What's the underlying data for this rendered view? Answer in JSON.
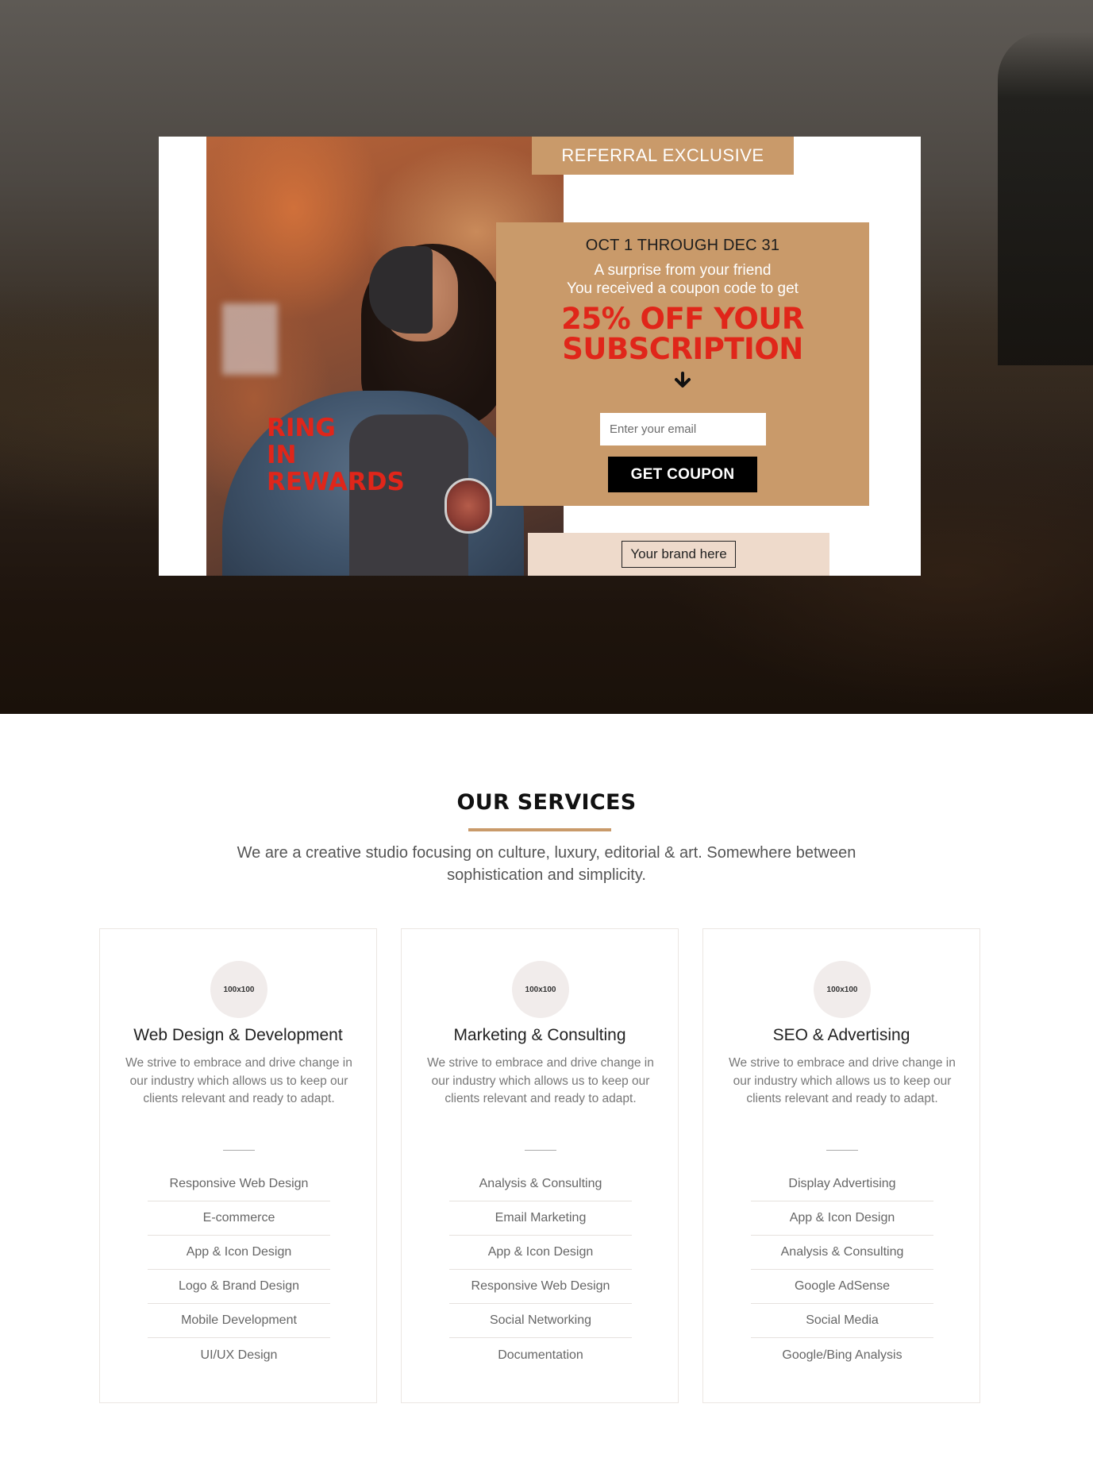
{
  "hero": {
    "tag": "REFERRAL EXCLUSIVE",
    "headline_lines": [
      "RING",
      "IN",
      "REWARDS"
    ],
    "promo": {
      "dates": "OCT 1 THROUGH DEC 31",
      "line1": "A surprise from your friend",
      "line2": "You received a coupon code to get",
      "offer_line1": "25% OFF YOUR",
      "offer_line2": "SUBSCRIPTION",
      "arrow_icon": "arrow-down-icon",
      "email_placeholder": "Enter your email",
      "button_label": "GET COUPON"
    },
    "brand_label": "Your brand here"
  },
  "services": {
    "title": "OUR SERVICES",
    "intro": "We are a creative studio focusing on culture, luxury, editorial & art. Somewhere between sophistication and simplicity.",
    "columns": [
      {
        "image_label": "100x100",
        "name": "Web Design & Development",
        "desc": "We strive to embrace and drive change in our industry which allows us to keep our clients relevant and ready to adapt.",
        "items": [
          "Responsive Web Design",
          "E-commerce",
          "App & Icon Design",
          "Logo & Brand Design",
          "Mobile Development",
          "UI/UX Design"
        ]
      },
      {
        "image_label": "100x100",
        "name": "Marketing & Consulting",
        "desc": "We strive to embrace and drive change in our industry which allows us to keep our clients relevant and ready to adapt.",
        "items": [
          "Analysis & Consulting",
          "Email Marketing",
          "App & Icon Design",
          "Responsive Web Design",
          "Social Networking",
          "Documentation"
        ]
      },
      {
        "image_label": "100x100",
        "name": "SEO & Advertising",
        "desc": "We strive to embrace and drive change in our industry which allows us to keep our clients relevant and ready to adapt.",
        "items": [
          "Display Advertising",
          "App & Icon Design",
          "Analysis & Consulting",
          "Google AdSense",
          "Social Media",
          "Google/Bing Analysis"
        ]
      }
    ]
  },
  "colors": {
    "accent": "#c99a6a",
    "offer_red": "#e0261a",
    "brand_bar": "#eedacb",
    "button": "#000000"
  }
}
